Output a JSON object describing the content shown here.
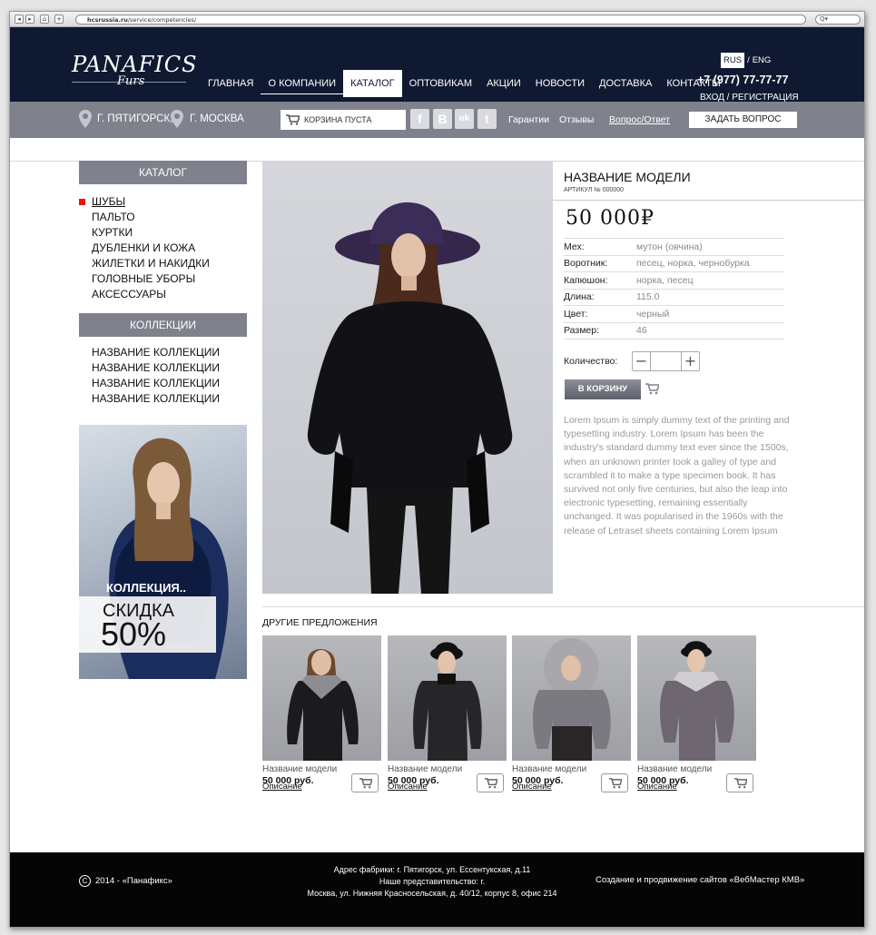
{
  "browser": {
    "url_domain": "hcsrussia.ru",
    "url_path": "/service/competencies/",
    "search_placeholder": "Q▾"
  },
  "brand": {
    "logo_main": "PANAFICS",
    "logo_sub": "Furs"
  },
  "nav": {
    "items": [
      "ГЛАВНАЯ",
      "О КОМПАНИИ",
      "КАТАЛОГ",
      "ОПТОВИКАМ",
      "АКЦИИ",
      "НОВОСТИ",
      "ДОСТАВКА",
      "КОНТАКТЫ"
    ],
    "active_index": 2
  },
  "header": {
    "lang_rus": "RUS",
    "lang_sep": "/",
    "lang_eng": "ENG",
    "phone": "+7 (977) 77-77-77",
    "login": "ВХОД / РЕГИСТРАЦИЯ"
  },
  "subbar": {
    "city1": "Г. ПЯТИГОРСК,",
    "city2": "Г. МОСКВА",
    "cart": "КОРЗИНА ПУСТА",
    "social": [
      "f",
      "B",
      "ok",
      "t"
    ],
    "links": [
      "Гарантии",
      "Отзывы",
      "Вопрос/Ответ"
    ],
    "ask_button": "ЗАДАТЬ ВОПРОС"
  },
  "sidebar": {
    "catalog_title": "КАТАЛОГ",
    "catalog_items": [
      "ШУБЫ",
      "ПАЛЬТО",
      "КУРТКИ",
      "ДУБЛЕНКИ И КОЖА",
      "ЖИЛЕТКИ И НАКИДКИ",
      "ГОЛОВНЫЕ УБОРЫ",
      "АКСЕССУАРЫ"
    ],
    "active_catalog": 0,
    "collections_title": "КОЛЛЕКЦИИ",
    "collection_items": [
      "НАЗВАНИЕ КОЛЛЕКЦИИ",
      "НАЗВАНИЕ КОЛЛЕКЦИИ",
      "НАЗВАНИЕ КОЛЛЕКЦИИ",
      "НАЗВАНИЕ КОЛЛЕКЦИИ"
    ],
    "promo_label": "КОЛЛЕКЦИЯ..",
    "promo_discount": "СКИДКА",
    "promo_percent": "50%"
  },
  "product": {
    "title": "НАЗВАНИЕ МОДЕЛИ",
    "article": "АРТИКУЛ № 000000",
    "price": "50 000₽",
    "specs": [
      {
        "k": "Мех:",
        "v": "мутон (овчина)"
      },
      {
        "k": "Воротник:",
        "v": "песец, норка, чернобурка"
      },
      {
        "k": "Капюшон:",
        "v": "норка, песец"
      },
      {
        "k": "Длина:",
        "v": "115.0"
      },
      {
        "k": "Цвет:",
        "v": "черный"
      },
      {
        "k": "Размер:",
        "v": "46"
      }
    ],
    "qty_label": "Количество:",
    "minus": "−",
    "plus": "+",
    "buy_button": "В КОРЗИНУ",
    "description": "Lorem Ipsum is simply dummy text of the printing and typesetting industry. Lorem Ipsum has been the industry's standard dummy text ever since the 1500s, when an unknown printer took a galley of type and scrambled it to make a type specimen book. It has survived not only five centuries, but also the leap into electronic typesetting, remaining essentially unchanged. It was popularised in the 1960s with the release of Letraset sheets containing Lorem Ipsum"
  },
  "others": {
    "title": "ДРУГИЕ ПРЕДЛОЖЕНИЯ",
    "cards": [
      {
        "name": "Название модели",
        "price": "50 000 руб.",
        "desc": "Описание"
      },
      {
        "name": "Название модели",
        "price": "50 000 руб.",
        "desc": "Описание"
      },
      {
        "name": "Название модели",
        "price": "50 000 руб.",
        "desc": "Описание"
      },
      {
        "name": "Название модели",
        "price": "50 000 руб.",
        "desc": "Описание"
      }
    ]
  },
  "footer": {
    "copyright_symbol": "C",
    "copyright": "2014 - «Панафикс»",
    "address_line1": "Адрес фабрики: г. Пятигорск, ул. Ессентукская, д.11",
    "address_line2": "Наше представительство: г.",
    "address_line3": "Москва, ул. Нижняя Красносельская, д. 40/12, корпус 8, офис 214",
    "developer": "Создание и продвижение сайтов «ВебМастер КМВ»"
  },
  "colors": {
    "header_bg": "#0f1a32",
    "subbar_bg": "#7f828c",
    "accent_red": "#e11111",
    "footer_bg": "#050505"
  }
}
